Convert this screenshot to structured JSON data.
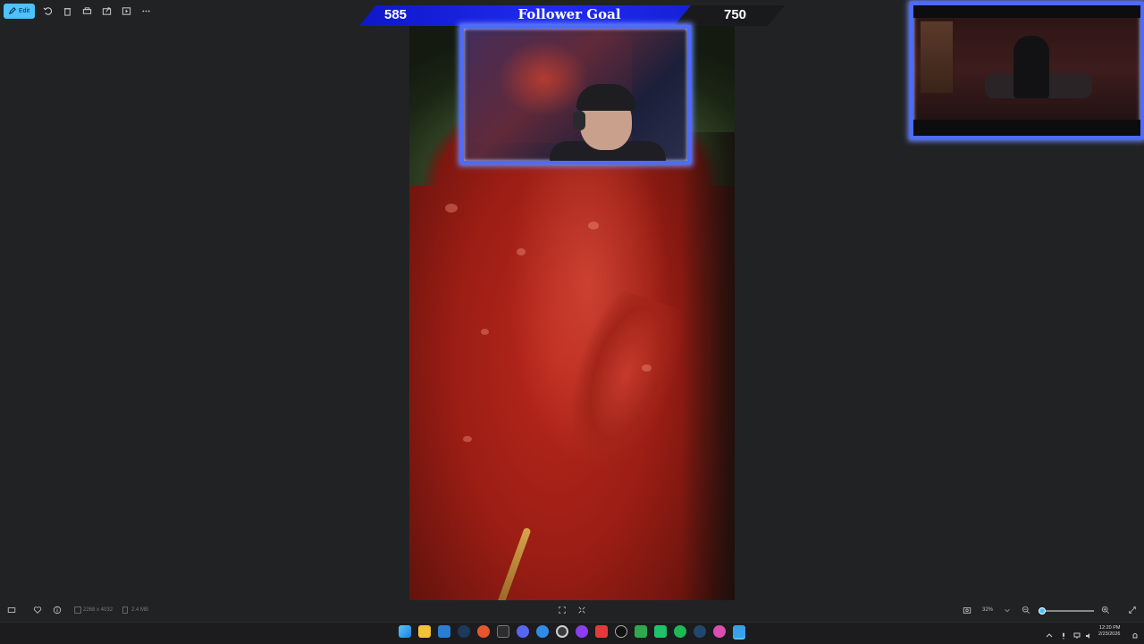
{
  "toolbar": {
    "edit_label": "Edit",
    "icons": [
      "rotate-icon",
      "delete-icon",
      "print-icon",
      "share-icon",
      "slideshow-icon",
      "more-icon"
    ]
  },
  "follower_goal": {
    "current": "585",
    "title": "Follower Goal",
    "target": "750",
    "progress": 0.78,
    "fill_color": "#1f2bf0"
  },
  "status_bar": {
    "dimensions": "2268 x 4032",
    "file_size": "2.4 MB",
    "zoom": "32%",
    "zoom_fraction": 0.07
  },
  "taskbar": {
    "time": "12:20 PM",
    "date": "2/23/2026",
    "apps": [
      "start",
      "file-explorer",
      "store",
      "steam",
      "browser-orange",
      "terminal",
      "discord",
      "app-blue",
      "obs",
      "app-purple",
      "app-red",
      "app-dark",
      "app-green",
      "app-green2",
      "spotify",
      "steam2",
      "app-pink",
      "photos"
    ]
  },
  "colors": {
    "accent": "#4cc2ff",
    "overlay_border": "#4d6bff"
  }
}
